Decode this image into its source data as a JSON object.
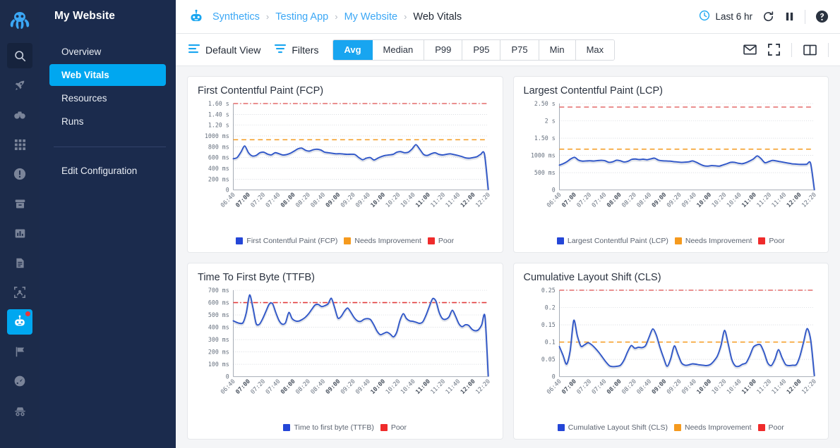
{
  "rail": {
    "logo": "datadog-octopus-logo",
    "items": [
      {
        "icon": "search-icon",
        "state": "boxed"
      },
      {
        "icon": "rocket-icon",
        "state": "normal"
      },
      {
        "icon": "watchdog-binoculars-icon",
        "state": "normal"
      },
      {
        "icon": "grid-apps-icon",
        "state": "normal"
      },
      {
        "icon": "alert-exclamation-icon",
        "state": "normal"
      },
      {
        "icon": "archive-box-icon",
        "state": "normal"
      },
      {
        "icon": "bar-chart-icon",
        "state": "normal"
      },
      {
        "icon": "document-icon",
        "state": "normal"
      },
      {
        "icon": "scan-frame-icon",
        "state": "normal"
      },
      {
        "icon": "synthetics-robot-icon",
        "state": "active",
        "badge": true
      },
      {
        "icon": "flag-icon",
        "state": "normal"
      },
      {
        "icon": "gauge-icon",
        "state": "normal"
      },
      {
        "icon": "incognito-icon",
        "state": "normal"
      }
    ]
  },
  "sidebar": {
    "title": "My Website",
    "items": [
      {
        "label": "Overview",
        "active": false
      },
      {
        "label": "Web Vitals",
        "active": true
      },
      {
        "label": "Resources",
        "active": false
      },
      {
        "label": "Runs",
        "active": false
      }
    ],
    "edit_configuration": "Edit Configuration"
  },
  "header": {
    "logo_icon": "synthetics-robot-icon",
    "breadcrumb": [
      {
        "label": "Synthetics",
        "current": false
      },
      {
        "label": "Testing App",
        "current": false
      },
      {
        "label": "My Website",
        "current": false
      },
      {
        "label": "Web Vitals",
        "current": true
      }
    ],
    "separator": "›",
    "time_range": {
      "icon": "clock-icon",
      "label": "Last 6 hr"
    },
    "refresh_icon": "refresh-icon",
    "pause_icon": "pause-icon",
    "help_icon": "help-circle-icon"
  },
  "toolbar": {
    "default_view": {
      "icon": "list-view-icon",
      "label": "Default View"
    },
    "filters": {
      "icon": "filter-funnel-icon",
      "label": "Filters"
    },
    "aggregations": [
      {
        "label": "Avg",
        "active": true
      },
      {
        "label": "Median",
        "active": false
      },
      {
        "label": "P99",
        "active": false
      },
      {
        "label": "P95",
        "active": false
      },
      {
        "label": "P75",
        "active": false
      },
      {
        "label": "Min",
        "active": false
      },
      {
        "label": "Max",
        "active": false
      }
    ],
    "email_icon": "email-icon",
    "fullscreen_icon": "fullscreen-icon",
    "columns_icon": "split-columns-icon"
  },
  "colors": {
    "series_blue": "#2f56c8",
    "legend_blue": "#2446d7",
    "needs_improvement": "#f59a1e",
    "poor": "#ef2b2b",
    "accent": "#18a5f0",
    "nav_dark": "#1b2b4d",
    "rail_dark": "#1c2b4a"
  },
  "x_ticks": [
    "06:40",
    "07:00",
    "07:20",
    "07:40",
    "08:00",
    "08:20",
    "08:40",
    "09:00",
    "09:20",
    "09:40",
    "10:00",
    "10:20",
    "10:40",
    "11:00",
    "11:20",
    "11:40",
    "12:00",
    "12:20"
  ],
  "x_ticks_bold": [
    "07:00",
    "08:00",
    "09:00",
    "10:00",
    "11:00",
    "12:00"
  ],
  "chart_data": [
    {
      "type": "line",
      "title": "First Contentful Paint (FCP)",
      "xlabel": "",
      "ylabel": "",
      "ylim": [
        0,
        1600
      ],
      "y_ticks": [
        0,
        200,
        400,
        600,
        800,
        1000,
        1200,
        1400,
        1600
      ],
      "y_tick_labels": [
        "0",
        "200 ms",
        "400 ms",
        "600 ms",
        "800 ms",
        "1000 ms",
        "1.20 s",
        "1.40 s",
        "1.60 s"
      ],
      "grid": true,
      "legend_position": "bottom",
      "thresholds": [
        {
          "name": "Poor",
          "value": 1600,
          "color": "#e36a6a",
          "style": "dash-dot"
        },
        {
          "name": "Needs Improvement",
          "value": 930,
          "color": "#f59a1e",
          "style": "dashed"
        }
      ],
      "series": [
        {
          "name": "First Contentful Paint (FCP)",
          "color": "#2f56c8",
          "values": [
            578,
            600,
            700,
            815,
            690,
            630,
            640,
            690,
            700,
            665,
            650,
            690,
            672,
            648,
            655,
            680,
            720,
            762,
            775,
            735,
            720,
            745,
            755,
            740,
            700,
            690,
            680,
            670,
            672,
            665,
            660,
            662,
            655,
            600,
            560,
            590,
            600,
            555,
            590,
            620,
            640,
            650,
            660,
            700,
            710,
            690,
            700,
            760,
            840,
            755,
            660,
            640,
            670,
            690,
            660,
            648,
            660,
            670,
            655,
            640,
            620,
            595,
            588,
            600,
            615,
            660,
            668,
            10
          ]
        }
      ],
      "legend": [
        {
          "label": "First Contentful Paint (FCP)",
          "color": "#2446d7"
        },
        {
          "label": "Needs Improvement",
          "color": "#f59a1e"
        },
        {
          "label": "Poor",
          "color": "#ef2b2b"
        }
      ]
    },
    {
      "type": "line",
      "title": "Largest Contentful Paint (LCP)",
      "xlabel": "",
      "ylabel": "",
      "ylim": [
        0,
        2500
      ],
      "y_ticks": [
        0,
        500,
        1000,
        1500,
        2000,
        2500
      ],
      "y_tick_labels": [
        "0",
        "500 ms",
        "1000 ms",
        "1.50 s",
        "2 s",
        "2.50 s"
      ],
      "grid": true,
      "legend_position": "bottom",
      "thresholds": [
        {
          "name": "Poor",
          "value": 2400,
          "color": "#e36a6a",
          "style": "dashed"
        },
        {
          "name": "Needs Improvement",
          "value": 1180,
          "color": "#f59a1e",
          "style": "dashed"
        }
      ],
      "series": [
        {
          "name": "Largest Contentful Paint (LCP)",
          "color": "#2f56c8",
          "values": [
            718,
            760,
            820,
            900,
            945,
            865,
            835,
            840,
            845,
            838,
            850,
            858,
            845,
            800,
            815,
            860,
            845,
            810,
            830,
            885,
            895,
            880,
            890,
            875,
            900,
            920,
            865,
            845,
            840,
            835,
            820,
            810,
            800,
            805,
            815,
            840,
            800,
            745,
            700,
            690,
            705,
            700,
            690,
            725,
            760,
            800,
            800,
            775,
            760,
            790,
            840,
            900,
            985,
            905,
            790,
            820,
            855,
            840,
            820,
            800,
            780,
            760,
            750,
            742,
            740,
            745,
            775,
            10
          ]
        }
      ],
      "legend": [
        {
          "label": "Largest Contentful Paint (LCP)",
          "color": "#2446d7"
        },
        {
          "label": "Needs Improvement",
          "color": "#f59a1e"
        },
        {
          "label": "Poor",
          "color": "#ef2b2b"
        }
      ]
    },
    {
      "type": "line",
      "title": "Time To First Byte (TTFB)",
      "xlabel": "",
      "ylabel": "",
      "ylim": [
        0,
        700
      ],
      "y_ticks": [
        0,
        100,
        200,
        300,
        400,
        500,
        600,
        700
      ],
      "y_tick_labels": [
        "0",
        "100 ms",
        "200 ms",
        "300 ms",
        "400 ms",
        "500 ms",
        "600 ms",
        "700 ms"
      ],
      "grid": true,
      "legend_position": "bottom",
      "thresholds": [
        {
          "name": "Poor",
          "value": 600,
          "color": "#e23c3c",
          "style": "dash-dot"
        }
      ],
      "series": [
        {
          "name": "Time to first byte (TTFB)",
          "color": "#2f56c8",
          "values": [
            452,
            440,
            432,
            438,
            520,
            662,
            560,
            430,
            425,
            470,
            530,
            588,
            592,
            520,
            455,
            425,
            438,
            520,
            470,
            452,
            450,
            462,
            480,
            508,
            545,
            580,
            585,
            568,
            575,
            590,
            635,
            560,
            475,
            488,
            530,
            556,
            520,
            478,
            452,
            448,
            465,
            470,
            462,
            420,
            368,
            340,
            350,
            360,
            345,
            322,
            360,
            455,
            510,
            470,
            452,
            448,
            440,
            432,
            445,
            500,
            570,
            632,
            612,
            520,
            470,
            465,
            485,
            538,
            490,
            430,
            405,
            420,
            415,
            385,
            372,
            380,
            420,
            488,
            5
          ]
        }
      ],
      "legend": [
        {
          "label": "Time to first byte (TTFB)",
          "color": "#2446d7"
        },
        {
          "label": "Poor",
          "color": "#ef2b2b"
        }
      ]
    },
    {
      "type": "line",
      "title": "Cumulative Layout Shift (CLS)",
      "xlabel": "",
      "ylabel": "",
      "ylim": [
        0,
        0.25
      ],
      "y_ticks": [
        0,
        0.05,
        0.1,
        0.15,
        0.2,
        0.25
      ],
      "y_tick_labels": [
        "0",
        "0.05",
        "0.1",
        "0.15",
        "0.2",
        "0.25"
      ],
      "grid": true,
      "legend_position": "bottom",
      "thresholds": [
        {
          "name": "Poor",
          "value": 0.25,
          "color": "#e36a6a",
          "style": "dash-dot"
        },
        {
          "name": "Needs Improvement",
          "value": 0.1,
          "color": "#f59a1e",
          "style": "dashed"
        }
      ],
      "series": [
        {
          "name": "Cumulative Layout Shift (CLS)",
          "color": "#2f56c8",
          "values": [
            0.087,
            0.062,
            0.036,
            0.075,
            0.163,
            0.118,
            0.088,
            0.092,
            0.098,
            0.092,
            0.082,
            0.07,
            0.056,
            0.042,
            0.031,
            0.029,
            0.03,
            0.033,
            0.048,
            0.072,
            0.09,
            0.082,
            0.085,
            0.084,
            0.09,
            0.115,
            0.138,
            0.12,
            0.085,
            0.055,
            0.03,
            0.052,
            0.089,
            0.065,
            0.04,
            0.033,
            0.034,
            0.037,
            0.036,
            0.034,
            0.033,
            0.032,
            0.035,
            0.045,
            0.06,
            0.09,
            0.134,
            0.095,
            0.05,
            0.031,
            0.03,
            0.036,
            0.04,
            0.06,
            0.085,
            0.092,
            0.092,
            0.07,
            0.04,
            0.032,
            0.05,
            0.078,
            0.055,
            0.035,
            0.032,
            0.033,
            0.035,
            0.06,
            0.1,
            0.139,
            0.105,
            0.003
          ]
        }
      ],
      "legend": [
        {
          "label": "Cumulative Layout Shift (CLS)",
          "color": "#2446d7"
        },
        {
          "label": "Needs Improvement",
          "color": "#f59a1e"
        },
        {
          "label": "Poor",
          "color": "#ef2b2b"
        }
      ]
    }
  ]
}
